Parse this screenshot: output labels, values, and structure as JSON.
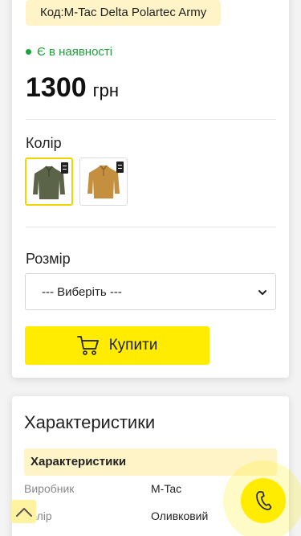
{
  "product": {
    "sku_label": "Код:M-Tac Delta Polartec Army",
    "stock_status": "Є в наявності",
    "price_amount": "1300",
    "price_currency": "грн"
  },
  "colors": {
    "label": "Колір",
    "options": [
      {
        "name": "olive",
        "color": "#5b6448",
        "selected": true
      },
      {
        "name": "coyote",
        "color": "#c4903f",
        "selected": false
      }
    ]
  },
  "size": {
    "label": "Розмір",
    "selected_value": "--- Виберіть ---"
  },
  "buy_button": {
    "label": "Купити",
    "color": "#ffec00"
  },
  "characteristics": {
    "title": "Характеристики",
    "table_header": "Характеристики",
    "rows": [
      {
        "key": "Виробник",
        "value": "M-Tac"
      },
      {
        "key": "Колір",
        "value": "Оливковий"
      }
    ]
  },
  "floating": {
    "scroll_top_icon": "chevron-up-icon",
    "call_icon": "phone-icon"
  },
  "theme": {
    "accent": "#ffec00",
    "soft_accent": "#fff4c8",
    "in_stock": "#1aa33a"
  }
}
